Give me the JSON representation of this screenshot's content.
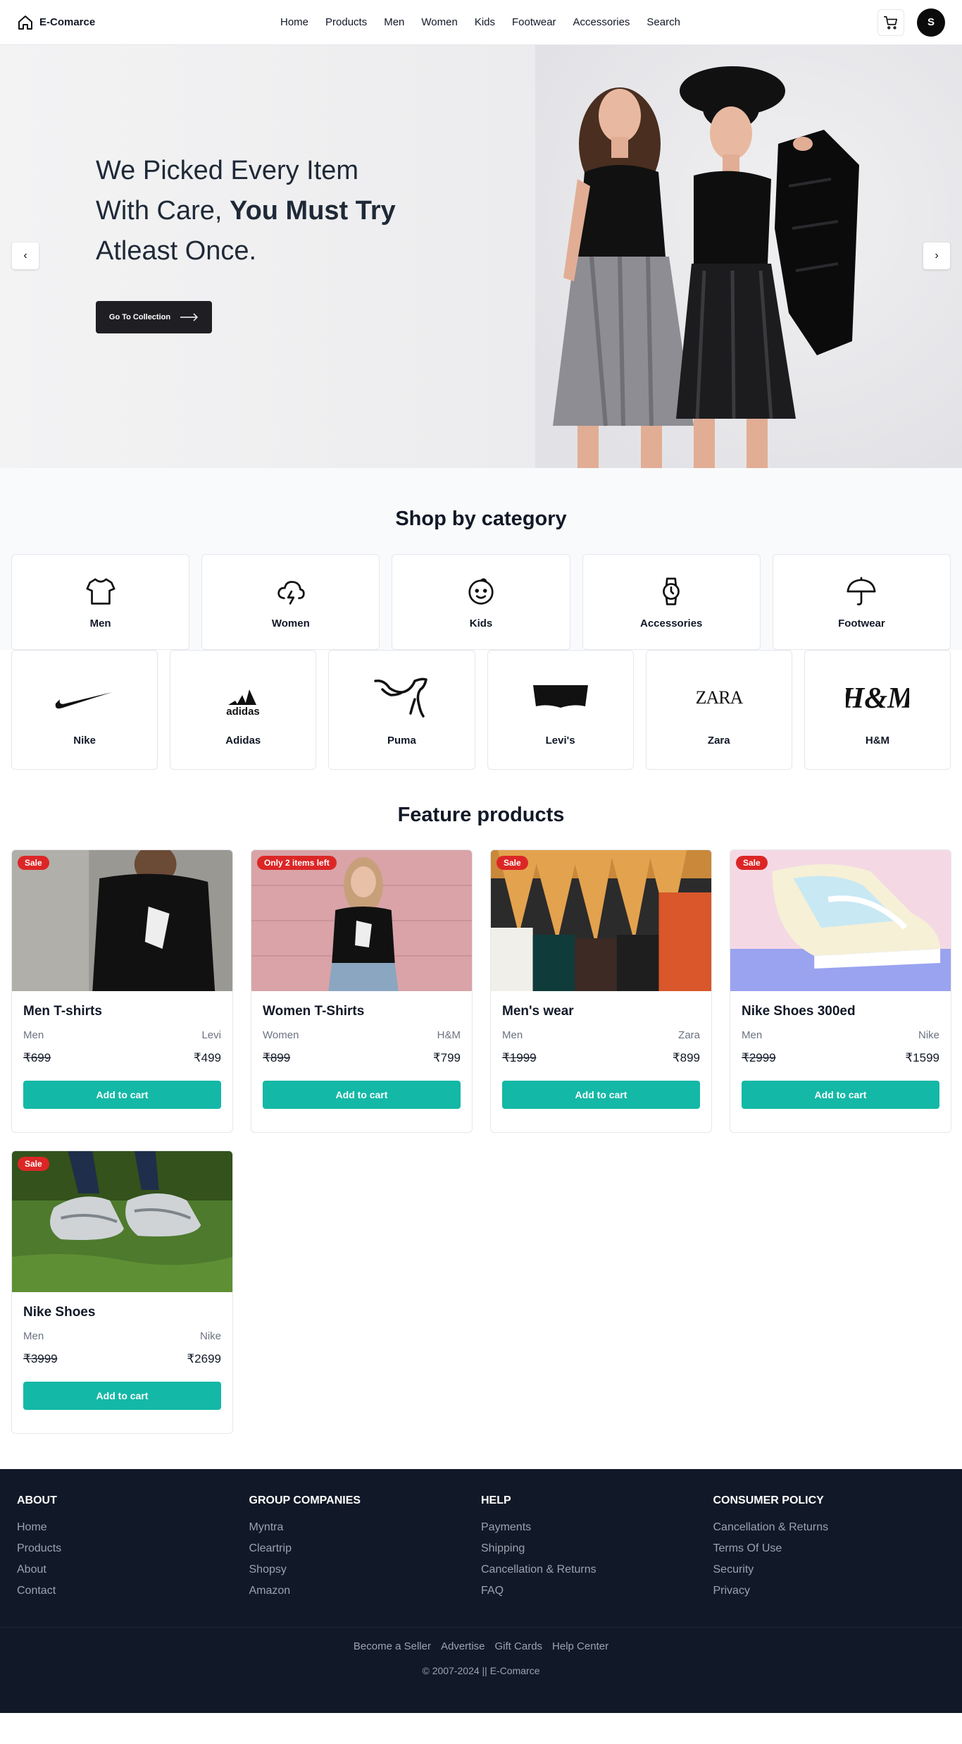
{
  "header": {
    "brand": "E-Comarce",
    "nav": [
      "Home",
      "Products",
      "Men",
      "Women",
      "Kids",
      "Footwear",
      "Accessories",
      "Search"
    ],
    "avatar_initial": "S"
  },
  "hero": {
    "line1": "We Picked Every Item",
    "line2_prefix": "With Care, ",
    "line2_bold": "You Must Try",
    "line3": "Atleast Once.",
    "cta": "Go To Collection",
    "prev": "‹",
    "next": "›"
  },
  "categories": {
    "title": "Shop by category",
    "items": [
      "Men",
      "Women",
      "Kids",
      "Accessories",
      "Footwear"
    ]
  },
  "brands": {
    "items": [
      "Nike",
      "Adidas",
      "Puma",
      "Levi's",
      "Zara",
      "H&M"
    ],
    "logo_text": {
      "adidas": "adidas",
      "zara": "ZARA",
      "hm": "H&M"
    }
  },
  "products": {
    "title": "Feature products",
    "add_label": "Add to cart",
    "items": [
      {
        "name": "Men T-shirts",
        "category": "Men",
        "brand": "Levi",
        "old_price": "₹699",
        "price": "₹499",
        "badge": "Sale"
      },
      {
        "name": "Women T-Shirts",
        "category": "Women",
        "brand": "H&M",
        "old_price": "₹899",
        "price": "₹799",
        "badge": "Only 2 items left"
      },
      {
        "name": "Men's wear",
        "category": "Men",
        "brand": "Zara",
        "old_price": "₹1999",
        "price": "₹899",
        "badge": "Sale"
      },
      {
        "name": "Nike Shoes 300ed",
        "category": "Men",
        "brand": "Nike",
        "old_price": "₹2999",
        "price": "₹1599",
        "badge": "Sale"
      },
      {
        "name": "Nike Shoes",
        "category": "Men",
        "brand": "Nike",
        "old_price": "₹3999",
        "price": "₹2699",
        "badge": "Sale"
      }
    ]
  },
  "footer": {
    "columns": [
      {
        "title": "ABOUT",
        "links": [
          "Home",
          "Products",
          "About",
          "Contact"
        ]
      },
      {
        "title": "GROUP COMPANIES",
        "links": [
          "Myntra",
          "Cleartrip",
          "Shopsy",
          "Amazon"
        ]
      },
      {
        "title": "HELP",
        "links": [
          "Payments",
          "Shipping",
          "Cancellation & Returns",
          "FAQ"
        ]
      },
      {
        "title": "CONSUMER POLICY",
        "links": [
          "Cancellation & Returns",
          "Terms Of Use",
          "Security",
          "Privacy"
        ]
      }
    ],
    "bottom_links": [
      "Become a Seller",
      "Advertise",
      "Gift Cards",
      "Help Center"
    ],
    "copyright": "© 2007-2024 || E-Comarce"
  },
  "colors": {
    "accent": "#14b8a6",
    "sale_badge": "#dc2626",
    "footer_bg": "#111827"
  },
  "icons": [
    "home-icon",
    "cart-icon",
    "tshirt-icon",
    "cloud-lightning-icon",
    "smile-icon",
    "watch-icon",
    "umbrella-icon",
    "arrow-right-icon"
  ]
}
